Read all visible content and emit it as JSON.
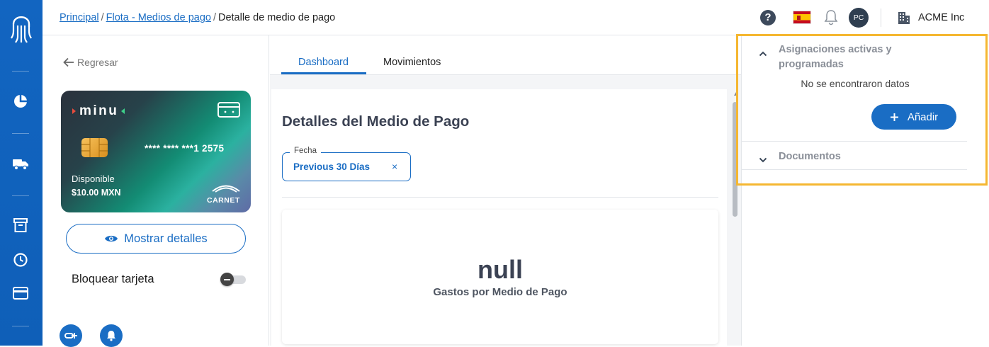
{
  "breadcrumb": {
    "principal": "Principal",
    "flota": "Flota - Medios de pago",
    "current": "Detalle de medio de pago",
    "sep": "/"
  },
  "header": {
    "company": "ACME Inc",
    "avatar_initials": "PC"
  },
  "left": {
    "back_label": "Regresar",
    "card": {
      "brand": "minu",
      "number": "**** **** ***1 2575",
      "available_label": "Disponible",
      "balance": "$10.00 MXN",
      "network": "CARNET"
    },
    "show_details": "Mostrar detalles",
    "block_card": "Bloquear tarjeta"
  },
  "main": {
    "tabs": [
      {
        "label": "Dashboard"
      },
      {
        "label": "Movimientos"
      }
    ],
    "title": "Detalles del Medio de Pago",
    "date_filter": {
      "label": "Fecha",
      "value": "Previous 30 Días",
      "clear": "×"
    },
    "kpi": {
      "value": "null",
      "label": "Gastos por Medio de Pago"
    }
  },
  "right": {
    "assignments_title": "Asignaciones activas y programadas",
    "empty_text": "No se encontraron datos",
    "add_label": "Añadir",
    "documents_title": "Documentos"
  },
  "colors": {
    "primary": "#1a6dc4",
    "sidebar": "#1265c1",
    "highlight": "#f5b731"
  }
}
